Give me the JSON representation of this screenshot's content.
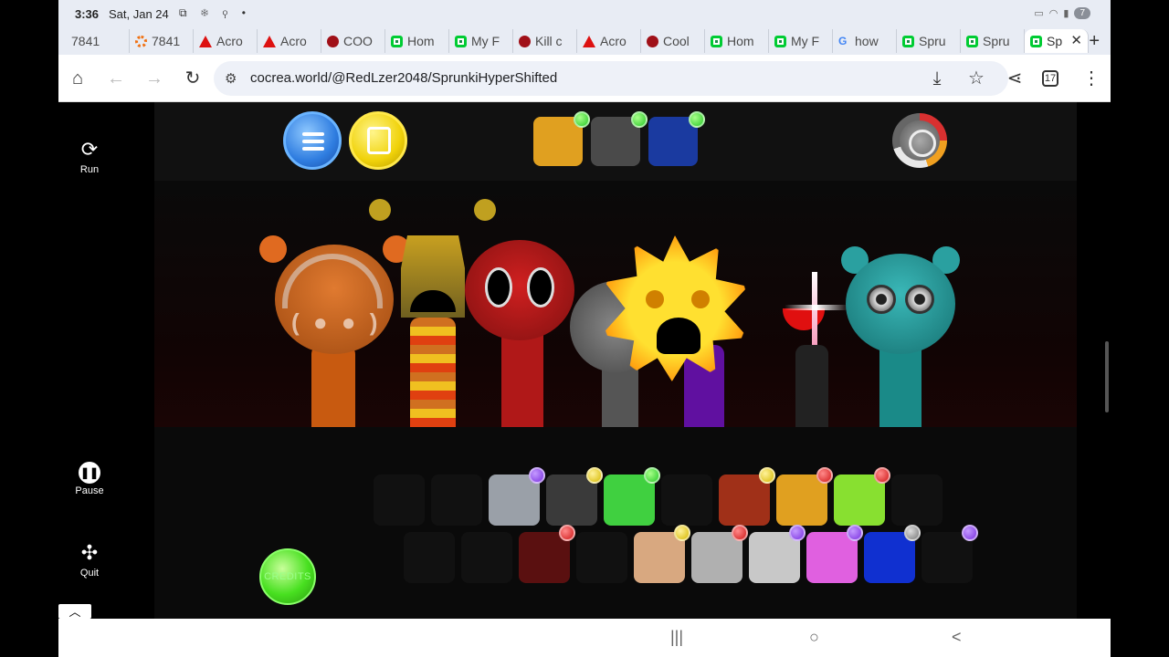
{
  "status": {
    "time": "3:36",
    "date": "Sat, Jan 24",
    "battery": "7"
  },
  "tabs": [
    {
      "label": "7841",
      "icon": "text-only"
    },
    {
      "label": "7841",
      "icon": "orange-spinner-icon"
    },
    {
      "label": "Acro",
      "icon": "acrobat-icon"
    },
    {
      "label": "Acro",
      "icon": "acrobat-icon"
    },
    {
      "label": "COO",
      "icon": "red-circle-icon"
    },
    {
      "label": "Hom",
      "icon": "cocrea-icon"
    },
    {
      "label": "My F",
      "icon": "cocrea-icon"
    },
    {
      "label": "Kill c",
      "icon": "red-circle-icon"
    },
    {
      "label": "Acro",
      "icon": "acrobat-icon"
    },
    {
      "label": "Cool",
      "icon": "red-circle-icon"
    },
    {
      "label": "Hom",
      "icon": "cocrea-icon"
    },
    {
      "label": "My F",
      "icon": "cocrea-icon"
    },
    {
      "label": "how",
      "icon": "google-icon"
    },
    {
      "label": "Spru",
      "icon": "cocrea-icon"
    },
    {
      "label": "Spru",
      "icon": "cocrea-icon"
    },
    {
      "label": "Sp",
      "icon": "cocrea-icon",
      "active": true
    }
  ],
  "browser": {
    "url": "cocrea.world/@RedLzer2048/SprunkiHyperShifted",
    "tab_count": "17",
    "new_tab": "+",
    "close_tab": "✕"
  },
  "sidebar": {
    "run_label": "Run",
    "pause_label": "Pause",
    "quit_label": "Quit"
  },
  "game": {
    "credits_label": "CREDITS",
    "collapse_label": "︿",
    "top_slots": [
      {
        "name": "dripping-orange-slot",
        "color": "#e0a020",
        "dot": "green"
      },
      {
        "name": "gray-antenna-slot",
        "color": "#4a4a4a",
        "dot": "green"
      },
      {
        "name": "blue-hat-slot",
        "color": "#1a3aa0",
        "dot": "green"
      }
    ],
    "row1": [
      {
        "name": "antenna-icon-slot",
        "color": "#1a1a1a",
        "dim": true,
        "dot": ""
      },
      {
        "name": "spiky-hair-slot",
        "color": "#1a1a1a",
        "dim": true,
        "dot": ""
      },
      {
        "name": "ufo-hat-slot",
        "color": "#9aa0a8",
        "dim": false,
        "dot": "purple"
      },
      {
        "name": "screen-head-slot",
        "color": "#3a3a3a",
        "dim": false,
        "dot": "yellow"
      },
      {
        "name": "flower-slot",
        "color": "#40d040",
        "dim": false,
        "dot": "green"
      },
      {
        "name": "horns-slot",
        "color": "#1a1a1a",
        "dim": true,
        "dot": ""
      },
      {
        "name": "bucket-slot",
        "color": "#a03018",
        "dim": false,
        "dot": "yellow"
      },
      {
        "name": "visor-slot",
        "color": "#e0a020",
        "dim": false,
        "dot": "red"
      },
      {
        "name": "leaf-slot",
        "color": "#88e030",
        "dim": false,
        "dot": "red"
      },
      {
        "name": "bear-ears-slot",
        "color": "#1a1a1a",
        "dim": true,
        "dot": ""
      }
    ],
    "row2": [
      {
        "name": "sun-slot",
        "color": "#1a1a1a",
        "dim": true,
        "dot": ""
      },
      {
        "name": "cat-ears-slot",
        "color": "#1a1a1a",
        "dim": true,
        "dot": ""
      },
      {
        "name": "tree-slot",
        "color": "#5a1010",
        "dim": false,
        "dot": "red"
      },
      {
        "name": "antenna-spikes-slot",
        "color": "#1a1a1a",
        "dim": true,
        "dot": ""
      },
      {
        "name": "bowler-hat-slot",
        "color": "#d8a880",
        "dim": false,
        "dot": "yellow"
      },
      {
        "name": "computer-slot",
        "color": "#b0b0b0",
        "dim": false,
        "dot": "red"
      },
      {
        "name": "envelope-slot",
        "color": "#c8c8c8",
        "dim": false,
        "dot": "purple"
      },
      {
        "name": "bunny-bow-slot",
        "color": "#e060e0",
        "dim": false,
        "dot": "purple"
      },
      {
        "name": "shadow-head-slot",
        "color": "#1030d0",
        "dim": false,
        "dot": "gray"
      },
      {
        "name": "top-hat-slot",
        "color": "#111111",
        "dim": false,
        "dot": "purple"
      }
    ]
  },
  "nav": {
    "recents": "|||",
    "home": "○",
    "back": "<"
  }
}
